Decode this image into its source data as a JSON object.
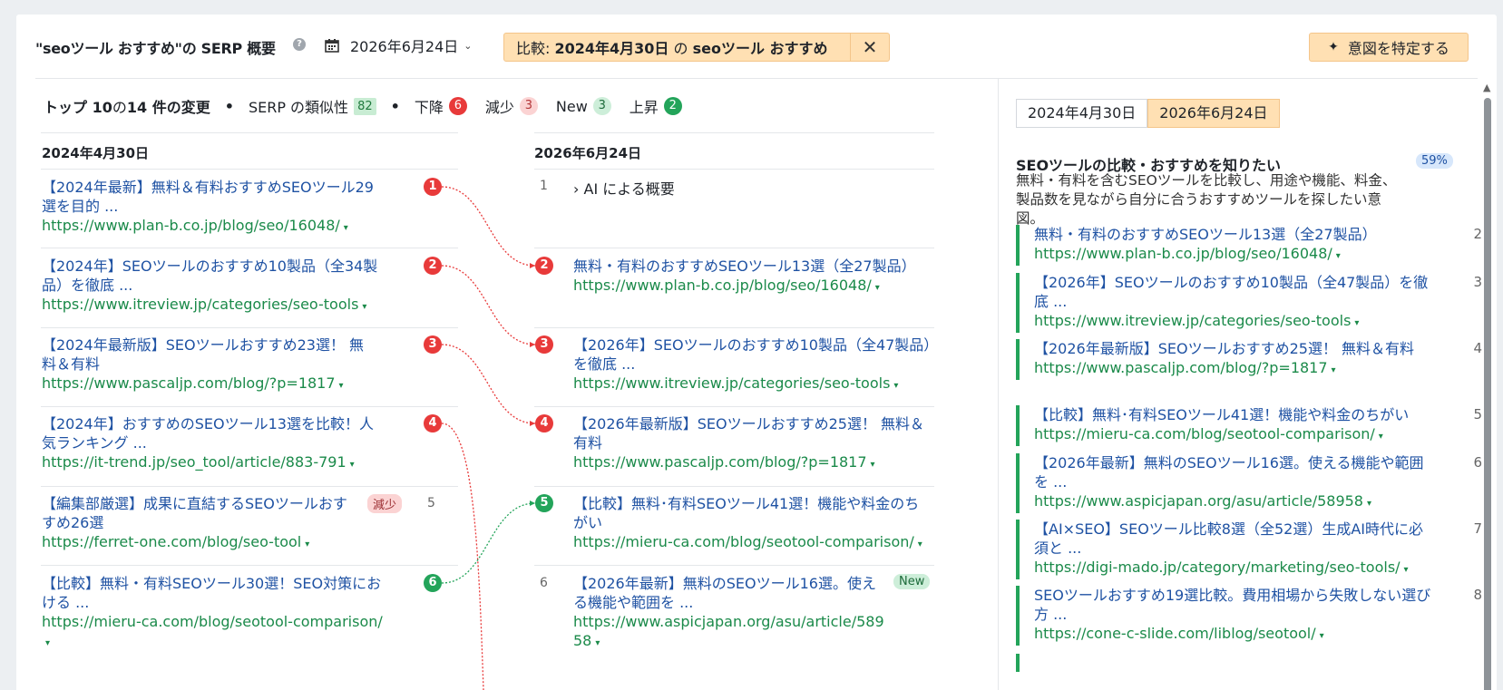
{
  "header": {
    "title": "\"seoツール おすすめ\"の SERP 概要",
    "help_icon": "?",
    "date": "2026年6月24日",
    "compare_prefix": "比較: ",
    "compare_date": "2024年4月30日",
    "compare_mid": " の ",
    "compare_keyword": "seoツール おすすめ",
    "close_icon": "✕",
    "intent_button": "意図を特定する"
  },
  "summary": {
    "lead": "トップ 10",
    "lead_mid": " の ",
    "lead_count": "14 件の変更",
    "dot": "•",
    "similarity_label": "SERP の類似性",
    "similarity_value": "82",
    "down_label": "下降",
    "down_count": "6",
    "decrease_label": "減少",
    "decrease_count": "3",
    "new_label": "New",
    "new_count": "3",
    "up_label": "上昇",
    "up_count": "2"
  },
  "left_column": {
    "header": "2024年4月30日",
    "rows": [
      {
        "title": "【2024年最新】無料＆有料おすすめSEOツール29選を目的 ...",
        "url": "https://www.plan-b.co.jp/blog/seo/16048/",
        "rank": "1"
      },
      {
        "title": "【2024年】SEOツールのおすすめ10製品（全34製品）を徹底 ...",
        "url": "https://www.itreview.jp/categories/seo-tools",
        "rank": "2"
      },
      {
        "title": "【2024年最新版】SEOツールおすすめ23選！ 無料＆有料",
        "url": "https://www.pascaljp.com/blog/?p=1817",
        "rank": "3"
      },
      {
        "title": "【2024年】おすすめのSEOツール13選を比較！人気ランキング ...",
        "url": "https://it-trend.jp/seo_tool/article/883-791",
        "rank": "4"
      },
      {
        "title": "【編集部厳選】成果に直結するSEOツールおすすめ26選",
        "url": "https://ferret-one.com/blog/seo-tool",
        "rank": "5",
        "tag": "減少"
      },
      {
        "title": "【比較】無料・有料SEOツール30選！SEO対策における ...",
        "url": "https://mieru-ca.com/blog/seotool-comparison/",
        "rank": "6"
      }
    ]
  },
  "middle_column": {
    "header": "2026年6月24日",
    "ai_rank": "1",
    "ai_label": "AI による概要",
    "rows": [
      {
        "title": "無料・有料のおすすめSEOツール13選（全27製品）",
        "url": "https://www.plan-b.co.jp/blog/seo/16048/",
        "rank": "2"
      },
      {
        "title": "【2026年】SEOツールのおすすめ10製品（全47製品）を徹底 ...",
        "url": "https://www.itreview.jp/categories/seo-tools",
        "rank": "3"
      },
      {
        "title": "【2026年最新版】SEOツールおすすめ25選！ 無料＆有料",
        "url": "https://www.pascaljp.com/blog/?p=1817",
        "rank": "4"
      },
      {
        "title": "【比較】無料･有料SEOツール41選！機能や料金のちがい",
        "url": "https://mieru-ca.com/blog/seotool-comparison/",
        "rank": "5"
      },
      {
        "title": "【2026年最新】無料のSEOツール16選。使える機能や範囲を ...",
        "url": "https://www.aspicjapan.org/asu/article/58958",
        "rank": "6",
        "tag": "New"
      }
    ]
  },
  "right_panel": {
    "tab_old": "2024年4月30日",
    "tab_new": "2026年6月24日",
    "intent_title": "SEOツールの比較・おすすめを知りたい",
    "intent_pct": "59%",
    "intent_desc": "無料・有料を含むSEOツールを比較し、用途や機能、料金、製品数を見ながら自分に合うおすすめツールを探したい意図。",
    "items": [
      {
        "title": "無料・有料のおすすめSEOツール13選（全27製品）",
        "url": "https://www.plan-b.co.jp/blog/seo/16048/",
        "rank": "2"
      },
      {
        "title": "【2026年】SEOツールのおすすめ10製品（全47製品）を徹底 ...",
        "url": "https://www.itreview.jp/categories/seo-tools",
        "rank": "3"
      },
      {
        "title": "【2026年最新版】SEOツールおすすめ25選！ 無料＆有料",
        "url": "https://www.pascaljp.com/blog/?p=1817",
        "rank": "4"
      },
      {
        "title": "【比較】無料･有料SEOツール41選！機能や料金のちがい",
        "url": "https://mieru-ca.com/blog/seotool-comparison/",
        "rank": "5"
      },
      {
        "title": "【2026年最新】無料のSEOツール16選。使える機能や範囲を ...",
        "url": "https://www.aspicjapan.org/asu/article/58958",
        "rank": "6"
      },
      {
        "title": "【AI×SEO】SEOツール比較8選（全52選）生成AI時代に必須と ...",
        "url": "https://digi-mado.jp/category/marketing/seo-tools/",
        "rank": "7"
      },
      {
        "title": "SEOツールおすすめ19選比較。費用相場から失敗しない選び方 ...",
        "url": "https://cone-c-slide.com/liblog/seotool/",
        "rank": "8"
      }
    ]
  },
  "caret": "▾",
  "colors": {
    "accent_orange": "#ffe0b3",
    "link_blue": "#1f52a3",
    "url_green": "#1b8a4a",
    "down_red": "#e83a3a",
    "up_green": "#23a45a"
  }
}
